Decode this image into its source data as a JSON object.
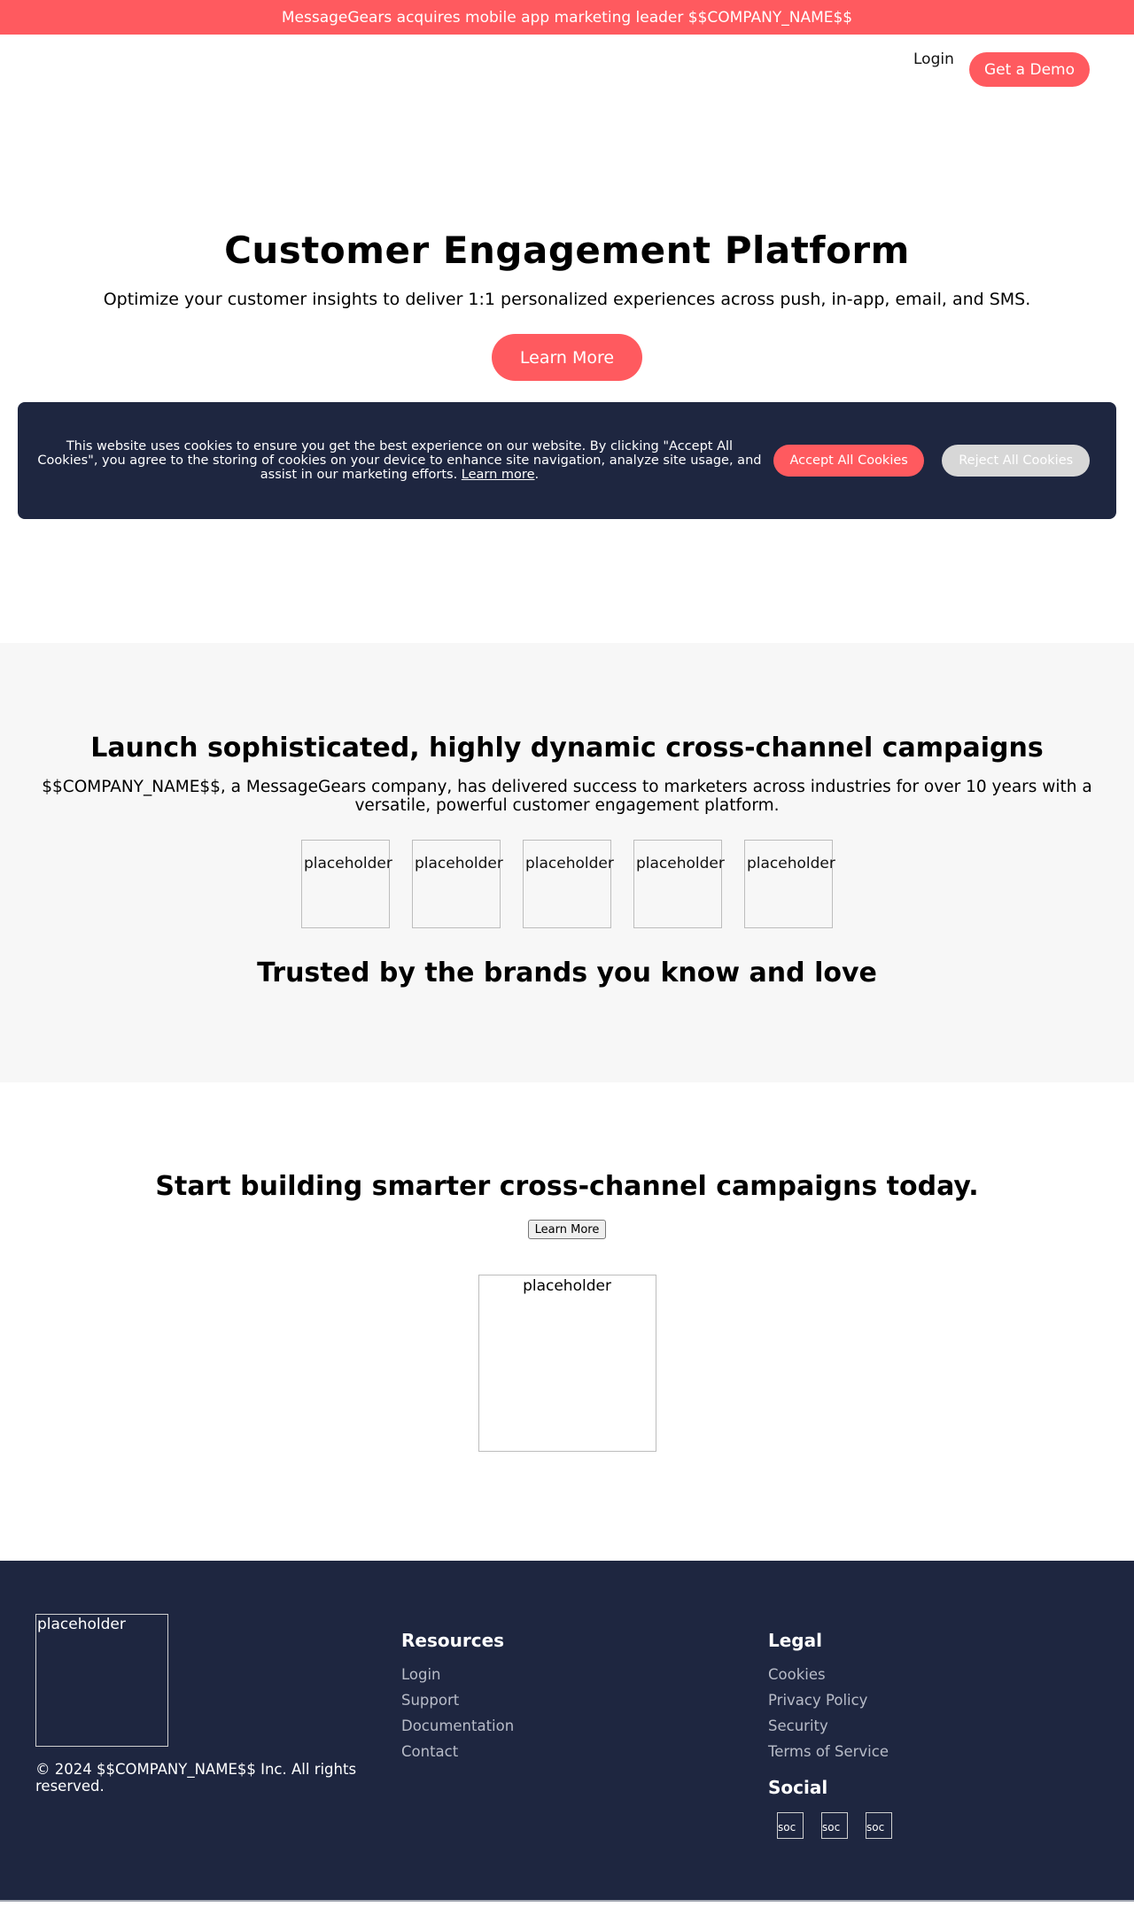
{
  "announcement": "MessageGears acquires mobile app marketing leader $$COMPANY_NAME$$",
  "nav": {
    "login": "Login",
    "demo": "Get a Demo"
  },
  "hero": {
    "title": "Customer Engagement Platform",
    "subtitle": "Optimize your customer insights to deliver 1:1 personalized experiences across push, in-app, email, and SMS.",
    "cta": "Learn More"
  },
  "cookie": {
    "message": "This website uses cookies to ensure you get the best experience on our website. By clicking \"Accept All Cookies\", you agree to the storing of cookies on your device to enhance site navigation, analyze site usage, and assist in our marketing efforts.",
    "learn_more": "Learn more",
    "period": ".",
    "accept": "Accept All Cookies",
    "reject": "Reject All Cookies"
  },
  "features": {
    "title": "Launch sophisticated, highly dynamic cross-channel campaigns",
    "text": "$$COMPANY_NAME$$, a MessageGears company, has delivered success to marketers across industries for over 10 years with a versatile, powerful customer engagement platform.",
    "logos": [
      "placeholder",
      "placeholder",
      "placeholder",
      "placeholder",
      "placeholder"
    ],
    "trusted": "Trusted by the brands you know and love"
  },
  "cta_section": {
    "title": "Start building smarter cross-channel campaigns today.",
    "button": "Learn More",
    "image_alt": "placeholder"
  },
  "footer": {
    "logo_alt": "placeholder",
    "copyright": "© 2024 $$COMPANY_NAME$$ Inc. All rights reserved.",
    "resources_title": "Resources",
    "resources": [
      "Login",
      "Support",
      "Documentation",
      "Contact"
    ],
    "legal_title": "Legal",
    "legal": [
      "Cookies",
      "Privacy Policy",
      "Security",
      "Terms of Service"
    ],
    "social_title": "Social",
    "social_alts": [
      "soc",
      "soc",
      "soc"
    ]
  },
  "colors": {
    "accent": "#ff5a5f",
    "navy": "#1e2640",
    "light_gray": "#f7f7f7"
  }
}
